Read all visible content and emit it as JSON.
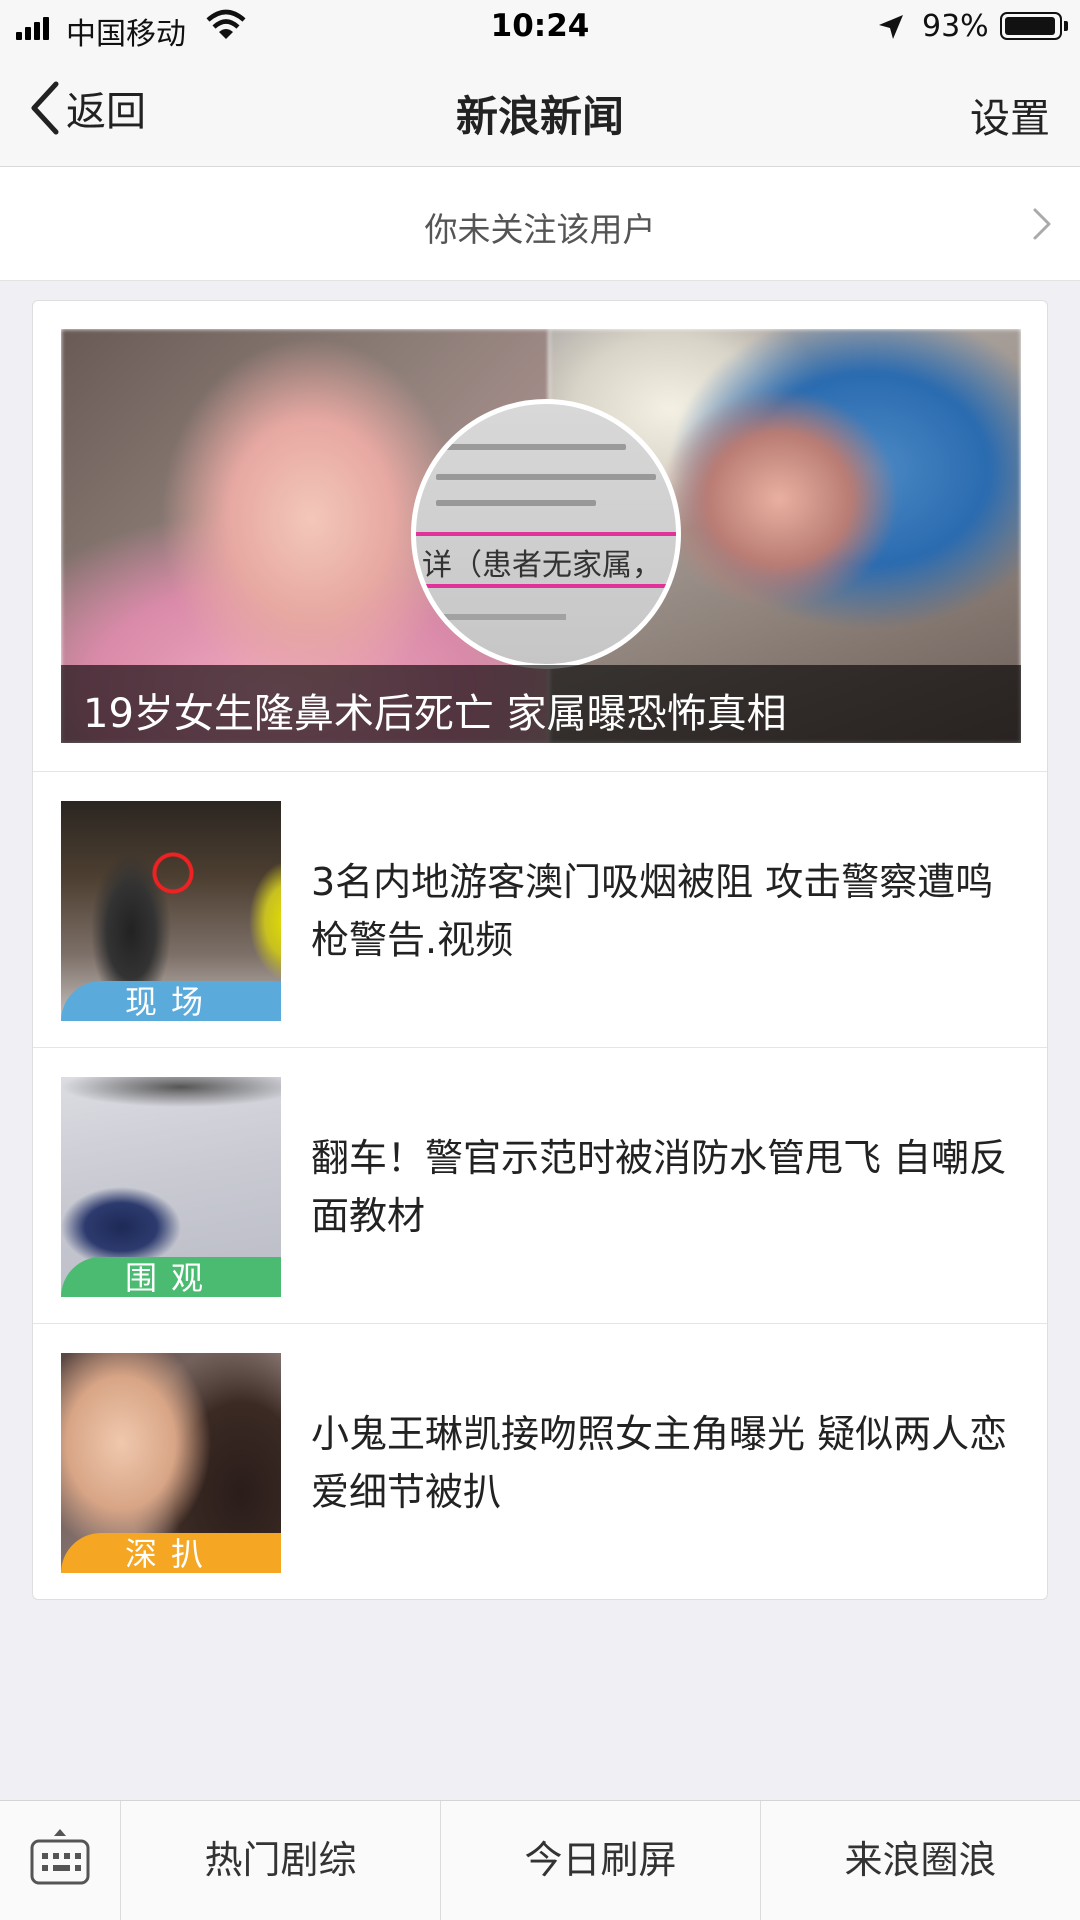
{
  "status_bar": {
    "carrier": "中国移动",
    "time": "10:24",
    "battery_percent": "93%",
    "battery_level": 0.93
  },
  "nav": {
    "back_label": "返回",
    "title": "新浪新闻",
    "settings_label": "设置"
  },
  "follow_banner": {
    "text": "你未关注该用户"
  },
  "hero": {
    "caption": "19岁女生隆鼻术后死亡 家属曝恐怖真相",
    "lens_text": "详（患者无家属，"
  },
  "news_items": [
    {
      "title": "3名内地游客澳门吸烟被阻 攻击警察遭鸣枪警告.视频",
      "tag": "现场",
      "tag_color": "#5aabdb"
    },
    {
      "title": "翻车！警官示范时被消防水管甩飞 自嘲反面教材",
      "tag": "围观",
      "tag_color": "#4cbb72"
    },
    {
      "title": "小鬼王琳凯接吻照女主角曝光 疑似两人恋爱细节被扒",
      "tag": "深扒",
      "tag_color": "#f5a623"
    }
  ],
  "bottom_menu": {
    "keyboard_icon": "keyboard-icon",
    "items": [
      "热门剧综",
      "今日刷屏",
      "来浪圈浪"
    ]
  }
}
